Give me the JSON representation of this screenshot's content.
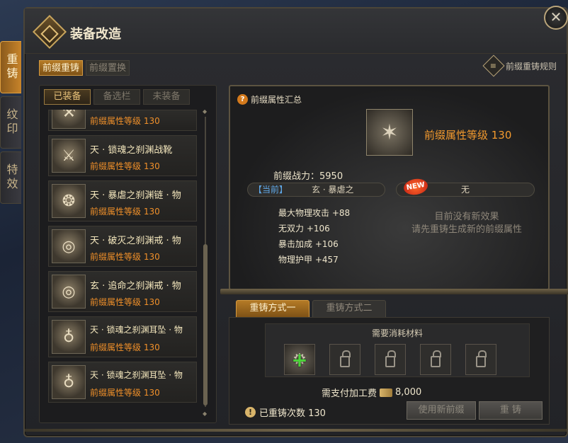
{
  "side_tabs": [
    "重铸",
    "纹印",
    "特效"
  ],
  "window": {
    "title": "装备改造",
    "close_glyph": "✕"
  },
  "top_tabs": [
    "前缀重铸",
    "前缀置换"
  ],
  "rules_label": "前缀重铸规则",
  "list_tabs": [
    "已装备",
    "备选栏",
    "未装备"
  ],
  "items": [
    {
      "name": "",
      "level": "前缀属性等级 130",
      "icon": "boots-icon"
    },
    {
      "name": "天 · 锁魂之刹渊战靴",
      "level": "前缀属性等级 130",
      "icon": "boots-icon"
    },
    {
      "name": "天 · 暴虐之刹渊链 · 物",
      "level": "前缀属性等级 130",
      "icon": "necklace-icon"
    },
    {
      "name": "天 · 破灭之刹渊戒 · 物",
      "level": "前缀属性等级 130",
      "icon": "ring-icon"
    },
    {
      "name": "玄 · 追命之刹渊戒 · 物",
      "level": "前缀属性等级 130",
      "icon": "ring-icon"
    },
    {
      "name": "天 · 锁魂之刹渊耳坠 · 物",
      "level": "前缀属性等级 130",
      "icon": "earring-icon"
    },
    {
      "name": "天 · 锁魂之刹渊耳坠 · 物",
      "level": "前缀属性等级 130",
      "icon": "earring-icon"
    }
  ],
  "summary": {
    "header": "前缀属性汇总",
    "level": "前缀属性等级 130",
    "power": "前缀战力：5950",
    "current_tag": "【当前】",
    "current_name": "玄 · 暴虐之",
    "new_badge": "NEW",
    "new_value": "无",
    "stats": [
      "最大物理攻击 +88",
      "无双力 +106",
      "暴击加成 +106",
      "物理护甲 +457"
    ],
    "no_effect": [
      "目前没有新效果",
      "请先重铸生成新的前缀属性"
    ]
  },
  "method_tabs": [
    "重铸方式一",
    "重铸方式二"
  ],
  "materials": {
    "title": "需要消耗材料",
    "fee_label": "需支付加工费",
    "fee_value": "8,000",
    "recast_count": "已重铸次数 130"
  },
  "buttons": {
    "use_new": "使用新前缀",
    "recast": "重 铸"
  }
}
